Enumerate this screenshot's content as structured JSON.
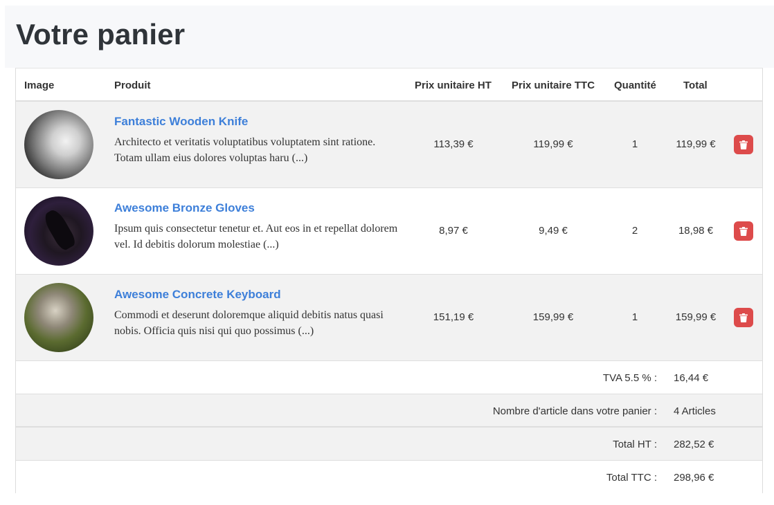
{
  "page": {
    "title": "Votre panier"
  },
  "table": {
    "headers": {
      "image": "Image",
      "product": "Produit",
      "unit_price_ht": "Prix unitaire HT",
      "unit_price_ttc": "Prix unitaire TTC",
      "quantity": "Quantité",
      "total": "Total"
    },
    "rows": [
      {
        "image_icon": "kitten-photo",
        "name": "Fantastic Wooden Knife",
        "description": "Architecto et veritatis voluptatibus voluptatem sint ratione. Totam ullam eius dolores voluptas haru (...)",
        "price_ht": "113,39 €",
        "price_ttc": "119,99 €",
        "quantity": "1",
        "total": "119,99 €",
        "delete_icon": "trash-icon"
      },
      {
        "image_icon": "person-photo",
        "name": "Awesome Bronze Gloves",
        "description": "Ipsum quis consectetur tenetur et. Aut eos in et repellat dolorem vel. Id debitis dolorum molestiae (...)",
        "price_ht": "8,97 €",
        "price_ttc": "9,49 €",
        "quantity": "2",
        "total": "18,98 €",
        "delete_icon": "trash-icon"
      },
      {
        "image_icon": "cat-photo",
        "name": "Awesome Concrete Keyboard",
        "description": "Commodi et deserunt doloremque aliquid debitis natus quasi nobis. Officia quis nisi qui quo possimus (...)",
        "price_ht": "151,19 €",
        "price_ttc": "159,99 €",
        "quantity": "1",
        "total": "159,99 €",
        "delete_icon": "trash-icon"
      }
    ]
  },
  "summary": {
    "tva_label": "TVA 5.5 % :",
    "tva_value": "16,44 €",
    "count_label": "Nombre d'article dans votre panier :",
    "count_value": "4 Articles",
    "total_ht_label": "Total HT :",
    "total_ht_value": "282,52 €",
    "total_ttc_label": "Total TTC :",
    "total_ttc_value": "298,96 €"
  },
  "colors": {
    "link": "#3d7fd9",
    "delete_button": "#dd4b4b",
    "header_bg": "#f7f8fa",
    "row_alt_bg": "#f2f2f2"
  }
}
